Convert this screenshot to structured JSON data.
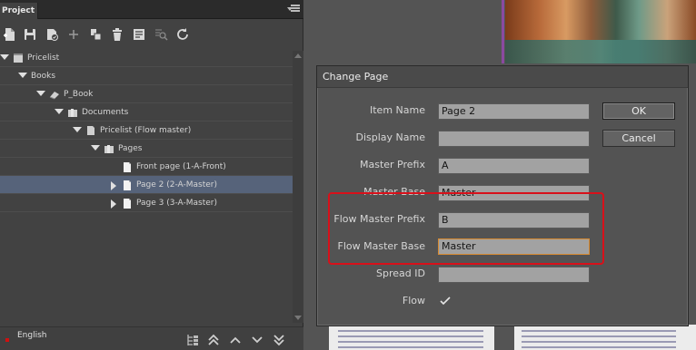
{
  "project_panel": {
    "tab_label": "Project",
    "tree": [
      {
        "label": "Pricelist",
        "level": 0,
        "expanded": true,
        "icon": "pricelist-icon",
        "selected": false
      },
      {
        "label": "Books",
        "level": 1,
        "expanded": true,
        "icon": "none",
        "selected": false
      },
      {
        "label": "P_Book",
        "level": 2,
        "expanded": true,
        "icon": "book-icon",
        "selected": false
      },
      {
        "label": "Documents",
        "level": 3,
        "expanded": true,
        "icon": "folder-icon",
        "selected": false
      },
      {
        "label": "Pricelist (Flow master)",
        "level": 4,
        "expanded": true,
        "icon": "document-icon",
        "selected": false
      },
      {
        "label": "Pages",
        "level": 5,
        "expanded": true,
        "icon": "folder-icon",
        "selected": false
      },
      {
        "label": "Front page (1-A-Front)",
        "level": 6,
        "expanded": null,
        "icon": "page-icon",
        "selected": false
      },
      {
        "label": "Page 2 (2-A-Master)",
        "level": 6,
        "expanded": false,
        "icon": "page-icon",
        "selected": true
      },
      {
        "label": "Page 3 (3-A-Master)",
        "level": 6,
        "expanded": false,
        "icon": "page-icon",
        "selected": false
      }
    ],
    "language": "English",
    "language_color": "#d01010",
    "selection_color": "#56637a"
  },
  "dialog": {
    "title": "Change Page",
    "fields": [
      {
        "label": "Item Name",
        "value": "Page 2",
        "focused": false
      },
      {
        "label": "Display Name",
        "value": "",
        "focused": false
      },
      {
        "label": "Master Prefix",
        "value": "A",
        "focused": false
      },
      {
        "label": "Master Base",
        "value": "Master",
        "focused": false
      },
      {
        "label": "Flow Master Prefix",
        "value": "B",
        "focused": false
      },
      {
        "label": "Flow Master Base",
        "value": "Master",
        "focused": true
      },
      {
        "label": "Spread ID",
        "value": "",
        "focused": false
      }
    ],
    "flow_label": "Flow",
    "flow_checked": true,
    "ok_label": "OK",
    "cancel_label": "Cancel",
    "highlight_color": "#d8101a"
  }
}
